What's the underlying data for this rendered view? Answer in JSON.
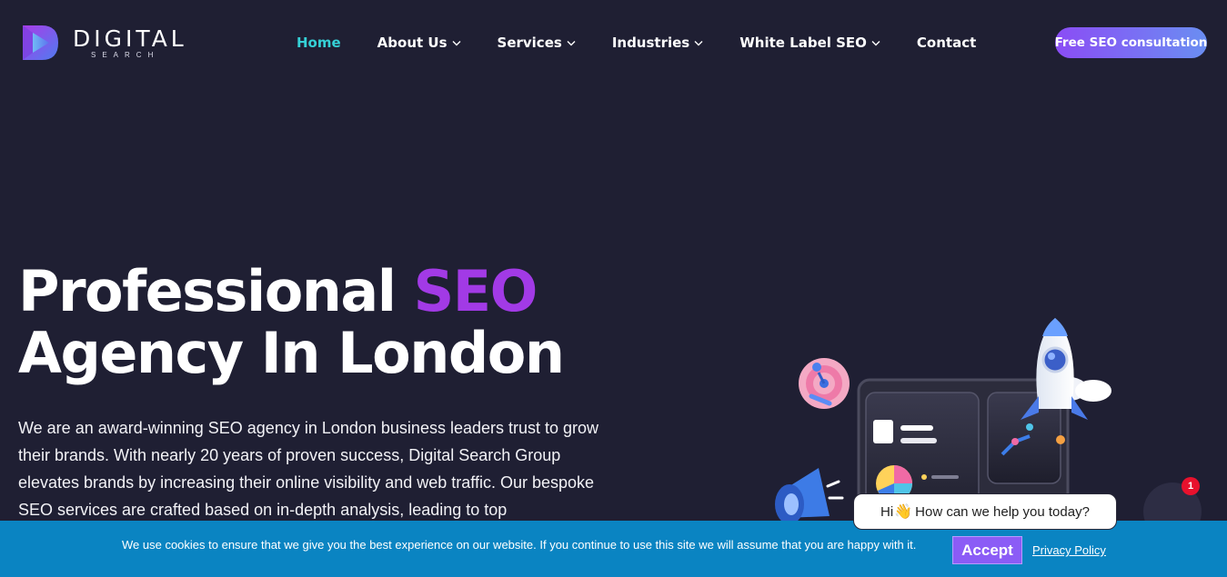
{
  "brand": {
    "name": "DIGITAL",
    "tagline": "SEARCH"
  },
  "nav": {
    "items": [
      {
        "label": "Home",
        "active": true,
        "dropdown": false
      },
      {
        "label": "About Us",
        "active": false,
        "dropdown": true
      },
      {
        "label": "Services",
        "active": false,
        "dropdown": true
      },
      {
        "label": "Industries",
        "active": false,
        "dropdown": true
      },
      {
        "label": "White Label SEO",
        "active": false,
        "dropdown": true
      },
      {
        "label": "Contact",
        "active": false,
        "dropdown": false
      }
    ],
    "cta_label": "Free SEO consultation"
  },
  "hero": {
    "title_part1": "Professional ",
    "title_accent": "SEO",
    "title_line2": "Agency In London",
    "description": "We are an award-winning SEO agency in London business leaders trust to grow their brands. With nearly 20 years of proven success, Digital Search Group elevates brands by increasing their online visibility and web traffic. Our bespoke SEO services are crafted based on in-depth analysis, leading to top"
  },
  "chat": {
    "greeting_pre": "Hi",
    "greeting_post": "How can we help you today?",
    "badge_count": "1"
  },
  "cookie": {
    "message": "We use cookies to ensure that we give you the best experience on our website. If you continue to use this site we will assume that you are happy with it.",
    "accept_label": "Accept",
    "privacy_label": "Privacy Policy"
  },
  "colors": {
    "background": "#1f1f33",
    "nav_active": "#35d0d6",
    "title_accent": "#a23ae6",
    "cookie_bar": "#0a84c2",
    "accept_button": "#8b5cf6",
    "badge": "#e8112d"
  },
  "icons": {
    "logo": "digital-search-logo-icon",
    "dropdown": "chevron-down-icon",
    "wave": "waving-hand-icon"
  }
}
